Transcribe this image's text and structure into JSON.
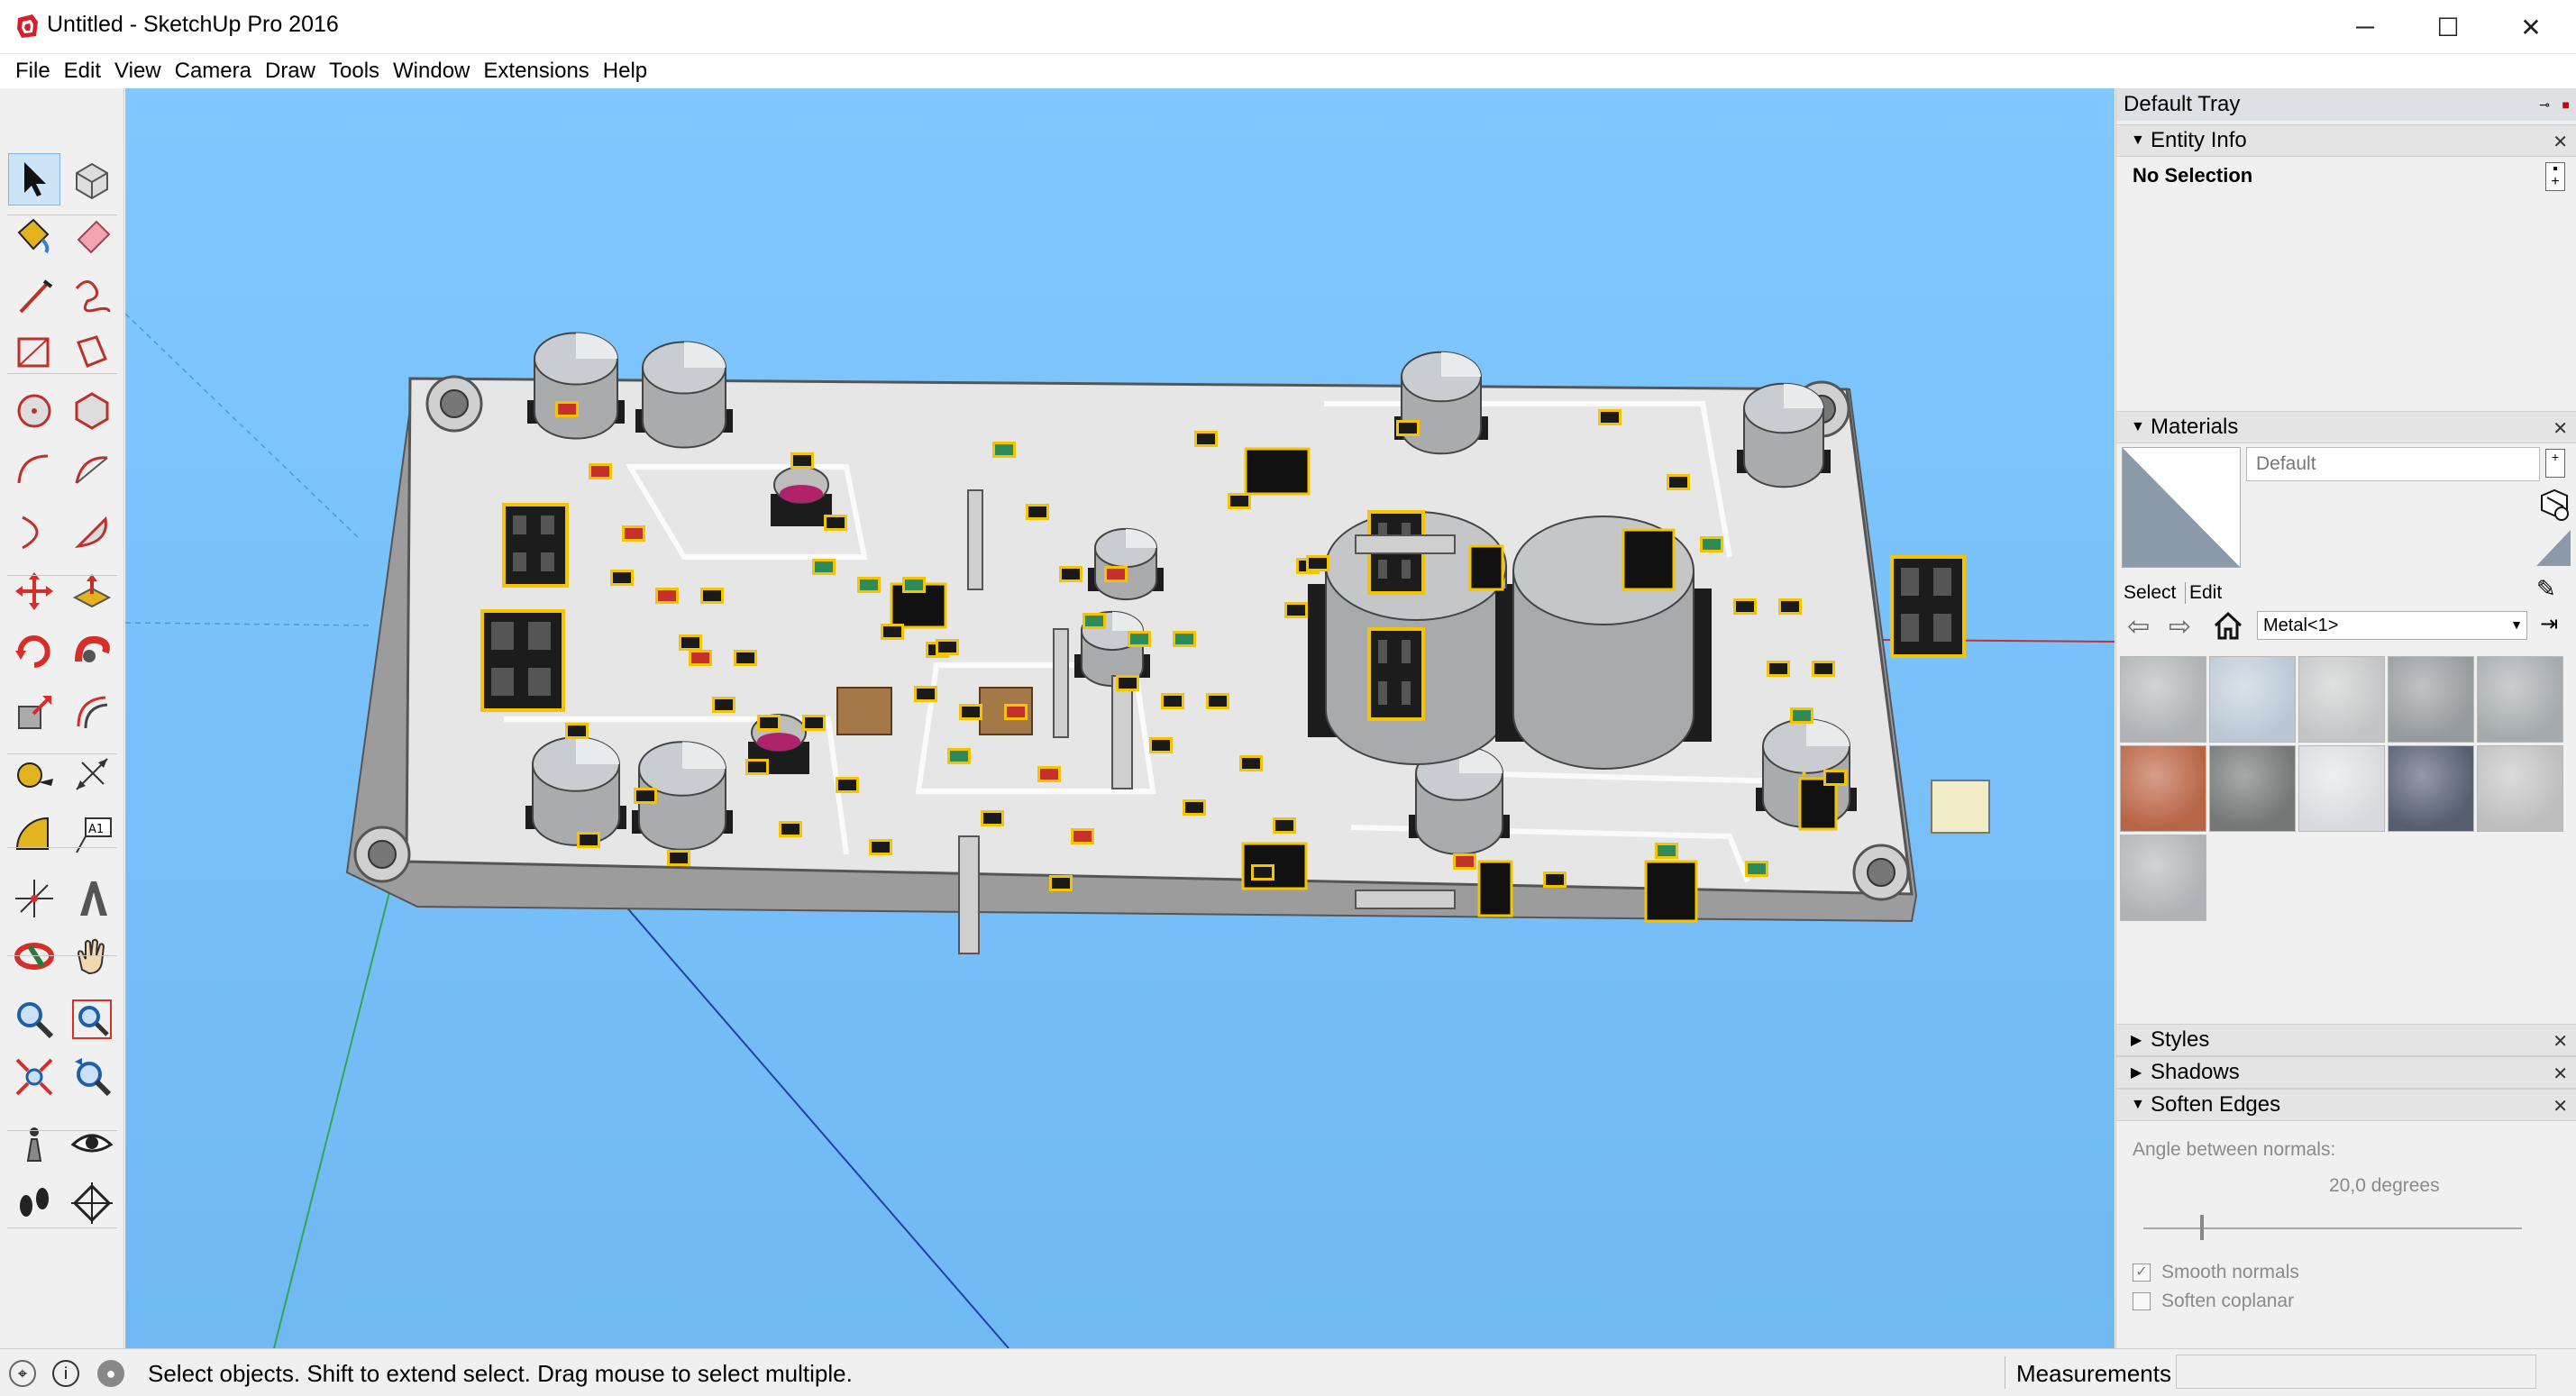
{
  "window": {
    "title": "Untitled - SketchUp Pro 2016",
    "controls": {
      "minimize": "─",
      "maximize": "☐",
      "close": "✕"
    }
  },
  "menu": [
    "File",
    "Edit",
    "View",
    "Camera",
    "Draw",
    "Tools",
    "Window",
    "Extensions",
    "Help"
  ],
  "toolbar": {
    "tools": [
      "select-tool",
      "make-component-tool",
      "paint-bucket-tool",
      "eraser-tool",
      "line-tool",
      "freehand-tool",
      "rectangle-tool",
      "rotated-rectangle-tool",
      "circle-tool",
      "polygon-tool",
      "arc-tool",
      "two-point-arc-tool",
      "three-point-arc-tool",
      "pie-tool",
      "move-tool",
      "push-pull-tool",
      "rotate-tool",
      "follow-me-tool",
      "scale-tool",
      "offset-tool",
      "tape-measure-tool",
      "dimension-tool",
      "protractor-tool",
      "text-tool",
      "axes-tool",
      "3d-text-tool",
      "orbit-tool",
      "pan-tool",
      "zoom-tool",
      "zoom-window-tool",
      "zoom-extents-tool",
      "previous-view-tool",
      "position-camera-tool",
      "look-around-tool",
      "walk-tool",
      "section-plane-tool"
    ]
  },
  "tray": {
    "title": "Default Tray",
    "entity_info": {
      "title": "Entity Info",
      "selection": "No Selection"
    },
    "materials": {
      "title": "Materials",
      "current_name": "Default",
      "tab_select": "Select",
      "tab_edit": "Edit",
      "library": "Metal<1>",
      "swatches": [
        "#b9bcbe",
        "#c5d3df",
        "#cfd0d1",
        "#9ea3a5",
        "#aeb4b6",
        "#c26a4a",
        "#7a7d7b",
        "#e4e6ea",
        "#5a6477",
        "#c8c8c8",
        "#b8bcc0"
      ]
    },
    "styles": {
      "title": "Styles"
    },
    "shadows": {
      "title": "Shadows"
    },
    "soften_edges": {
      "title": "Soften Edges",
      "angle_label": "Angle between normals:",
      "angle_value": "20,0  degrees",
      "smooth_normals": "Smooth normals",
      "soften_coplanar": "Soften coplanar",
      "smooth_checked": true,
      "coplanar_checked": false,
      "slider_fraction": 0.15
    }
  },
  "status": {
    "hint": "Select objects. Shift to extend select. Drag mouse to select multiple.",
    "measurements_label": "Measurements",
    "measurements_value": ""
  },
  "colors": {
    "sky": "#80c8ff",
    "board": "#e6e6e6",
    "pad": "#f5c400",
    "connector": "#1c1c1c",
    "capacitor": "#a9abad"
  }
}
